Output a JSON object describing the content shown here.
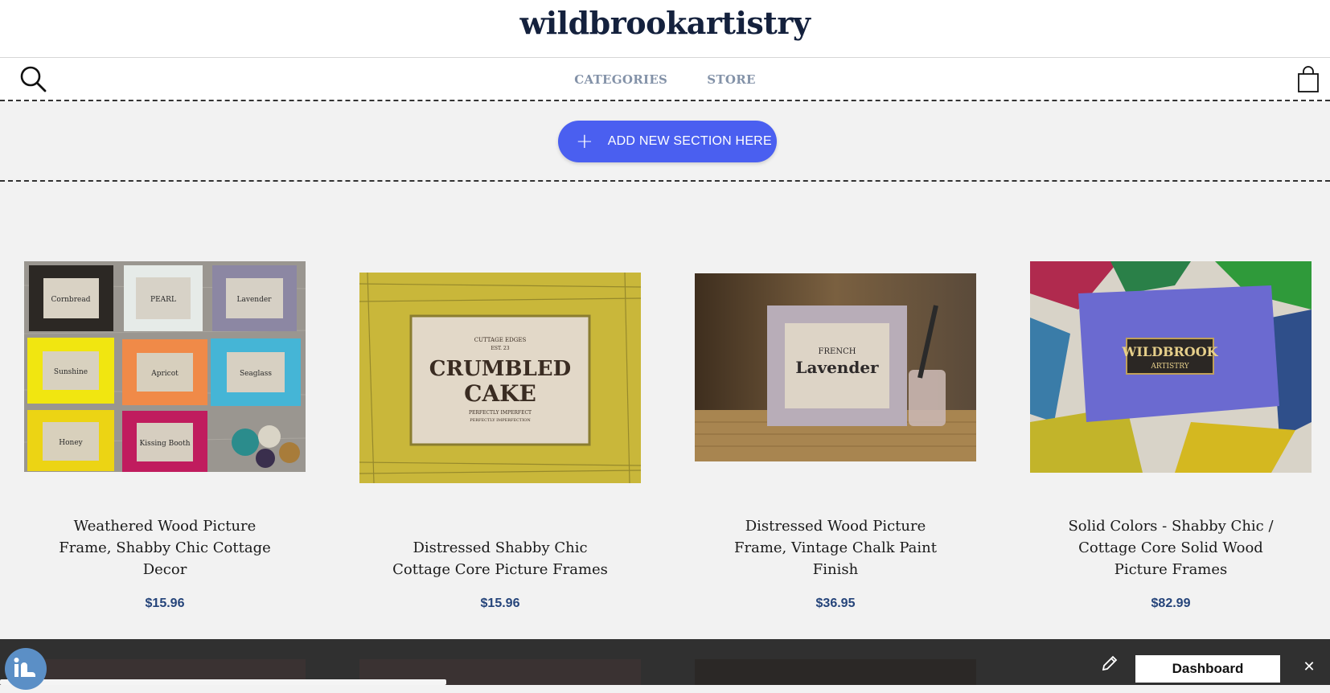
{
  "site": {
    "title": "wildbrookartistry"
  },
  "nav": {
    "items": [
      {
        "label": "CATEGORIES"
      },
      {
        "label": "STORE"
      }
    ],
    "search_icon": "search-icon",
    "cart_icon": "shopping-bag-icon"
  },
  "editor": {
    "add_section_label": "ADD NEW SECTION HERE",
    "add_icon": "plus-icon",
    "dashboard_label": "Dashboard",
    "close_glyph": "✕",
    "edit_icon": "pencil-icon",
    "accent_color": "#4a5ff0"
  },
  "products": [
    {
      "name": "Weathered Wood Picture Frame, Shabby Chic Cottage Decor",
      "price": "$15.96",
      "image_text": [
        "Cornbread",
        "PEARL",
        "Lavender",
        "Sunshine",
        "Apricot",
        "Seaglass",
        "Honey",
        "Kissing Booth"
      ]
    },
    {
      "name": "Distressed Shabby Chic Cottage Core Picture Frames",
      "price": "$15.96",
      "image_text": [
        "CUTTAGE EDGES",
        "EST. 23",
        "CRUMBLED",
        "CAKE",
        "PERFECTLY IMPERFECT",
        "PERFECTLY IMPERFECTION"
      ]
    },
    {
      "name": "Distressed Wood Picture Frame, Vintage Chalk Paint Finish",
      "price": "$36.95",
      "image_text": [
        "FRENCH",
        "Lavender"
      ]
    },
    {
      "name": "Solid Colors - Shabby Chic / Cottage Core Solid Wood Picture Frames",
      "price": "$82.99",
      "image_text": [
        "WILDBROOK",
        "ARTISTRY"
      ]
    }
  ],
  "colors": {
    "title": "#14213d",
    "nav_link": "#8392a8",
    "price": "#25447a",
    "bottom_bar": "#303030"
  }
}
